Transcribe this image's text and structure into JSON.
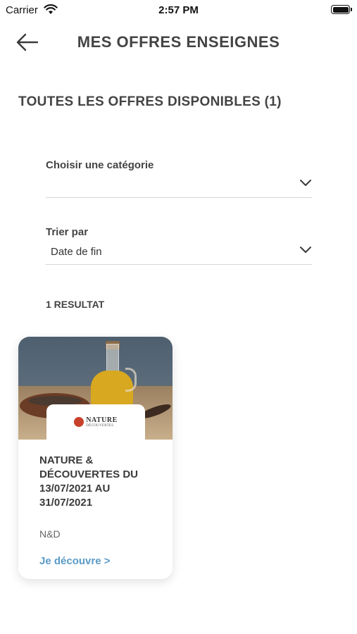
{
  "status_bar": {
    "carrier": "Carrier",
    "time": "2:57 PM"
  },
  "header": {
    "title": "MES OFFRES ENSEIGNES",
    "back_icon": "arrow-left-icon"
  },
  "section": {
    "title": "TOUTES LES OFFRES DISPONIBLES (1)"
  },
  "filters": {
    "category": {
      "label": "Choisir une catégorie",
      "value": ""
    },
    "sort": {
      "label": "Trier par",
      "value": "Date de fin"
    }
  },
  "results": {
    "count_label": "1 RESULTAT"
  },
  "offers": [
    {
      "logo_line1": "NATURE",
      "logo_line2": "DÉCOUVERTES",
      "title": "NATURE & DÉCOUVERTES DU 13/07/2021 AU 31/07/2021",
      "brand": "N&D",
      "cta": "Je découvre >"
    }
  ],
  "colors": {
    "link": "#5b9bc7",
    "text": "#444444",
    "divider": "#d6d6d6"
  }
}
